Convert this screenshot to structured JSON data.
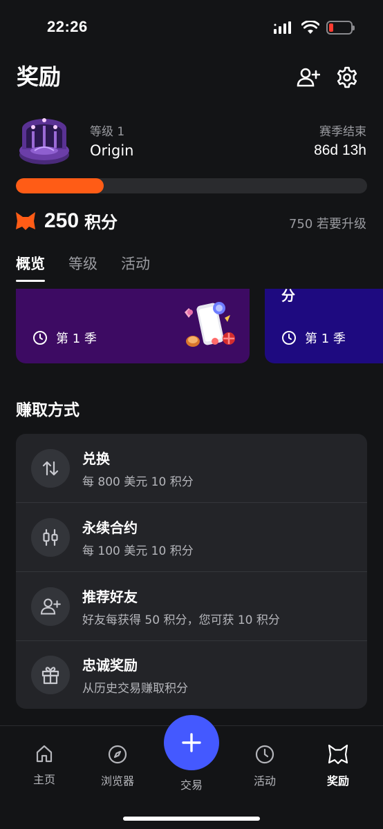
{
  "status_bar": {
    "time": "22:26",
    "battery_level": 0.2,
    "battery_color": "#ff3b30"
  },
  "header": {
    "title": "奖励",
    "icons": [
      "add-user-icon",
      "settings-icon"
    ]
  },
  "level": {
    "label": "等级 1",
    "name": "Origin",
    "season_label": "赛季结束",
    "season_remaining": "86d 13h",
    "progress": 0.25,
    "progress_color": "#ff5c16"
  },
  "points": {
    "value": "250",
    "unit": "积分",
    "to_upgrade": "750 若要升级"
  },
  "tabs": [
    {
      "label": "概览",
      "active": true
    },
    {
      "label": "等级",
      "active": false
    },
    {
      "label": "活动",
      "active": false
    }
  ],
  "season_cards": [
    {
      "season": "第 1 季",
      "color": "#3d0b63"
    },
    {
      "season": "第 1 季",
      "partial_title": "分",
      "color": "#1e0a80"
    }
  ],
  "earn": {
    "title": "赚取方式",
    "items": [
      {
        "name": "兑换",
        "desc": "每 800 美元 10 积分",
        "icon": "swap-icon"
      },
      {
        "name": "永续合约",
        "desc": "每 100 美元 10 积分",
        "icon": "candlestick-icon"
      },
      {
        "name": "推荐好友",
        "desc": "好友每获得 50 积分，您可获 10 积分",
        "icon": "add-user-icon"
      },
      {
        "name": "忠诚奖励",
        "desc": "从历史交易赚取积分",
        "icon": "gift-icon"
      }
    ]
  },
  "bottom_nav": {
    "items": [
      {
        "label": "主页",
        "icon": "home-icon"
      },
      {
        "label": "浏览器",
        "icon": "compass-icon"
      },
      {
        "label": "交易",
        "icon": "plus-icon"
      },
      {
        "label": "活动",
        "icon": "clock-icon"
      },
      {
        "label": "奖励",
        "icon": "fox-icon",
        "active": true
      }
    ],
    "fab_color": "#4459ff"
  }
}
